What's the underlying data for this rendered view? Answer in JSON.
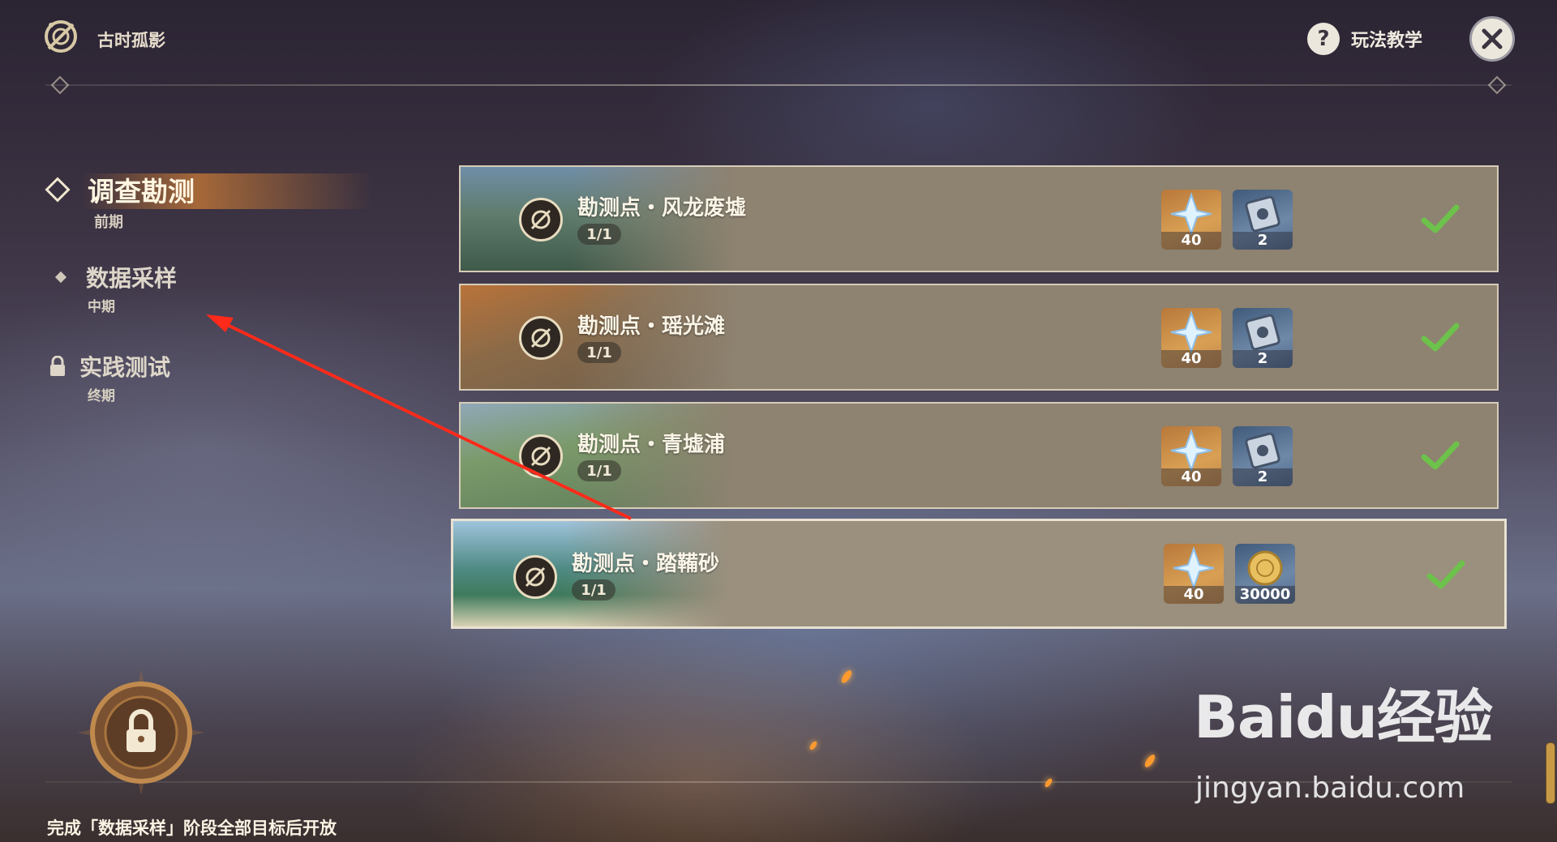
{
  "header": {
    "title": "古时孤影",
    "help_label": "玩法教学",
    "help_icon": "question-icon",
    "close_icon": "close-icon"
  },
  "nav": {
    "items": [
      {
        "title": "调查勘测",
        "subtitle": "前期",
        "state": "active",
        "icon": "diamond-icon"
      },
      {
        "title": "数据采样",
        "subtitle": "中期",
        "state": "normal",
        "icon": "diamond-icon"
      },
      {
        "title": "实践测试",
        "subtitle": "终期",
        "state": "locked",
        "icon": "lock-icon"
      }
    ]
  },
  "missions": [
    {
      "title": "勘测点・风龙废墟",
      "progress": "1/1",
      "rewards": [
        {
          "icon": "primogem-icon",
          "qty": "40"
        },
        {
          "icon": "hero-wit-book-icon",
          "qty": "2"
        }
      ],
      "completed": true
    },
    {
      "title": "勘测点・瑶光滩",
      "progress": "1/1",
      "rewards": [
        {
          "icon": "primogem-icon",
          "qty": "40"
        },
        {
          "icon": "hero-wit-book-icon",
          "qty": "2"
        }
      ],
      "completed": true
    },
    {
      "title": "勘测点・青墟浦",
      "progress": "1/1",
      "rewards": [
        {
          "icon": "primogem-icon",
          "qty": "40"
        },
        {
          "icon": "hero-wit-book-icon",
          "qty": "2"
        }
      ],
      "completed": true
    },
    {
      "title": "勘测点・踏鞴砂",
      "progress": "1/1",
      "rewards": [
        {
          "icon": "primogem-icon",
          "qty": "40"
        },
        {
          "icon": "mora-coin-icon",
          "qty": "30000"
        }
      ],
      "completed": true
    }
  ],
  "footer": {
    "unlock_note": "完成「数据采样」阶段全部目标后开放"
  },
  "watermark": {
    "logo": "Baidu经验",
    "url": "jingyan.baidu.com"
  },
  "colors": {
    "accent_orange": "#ff9a2e",
    "check_green": "#6cc24a",
    "card_bg": "#8e8270"
  }
}
